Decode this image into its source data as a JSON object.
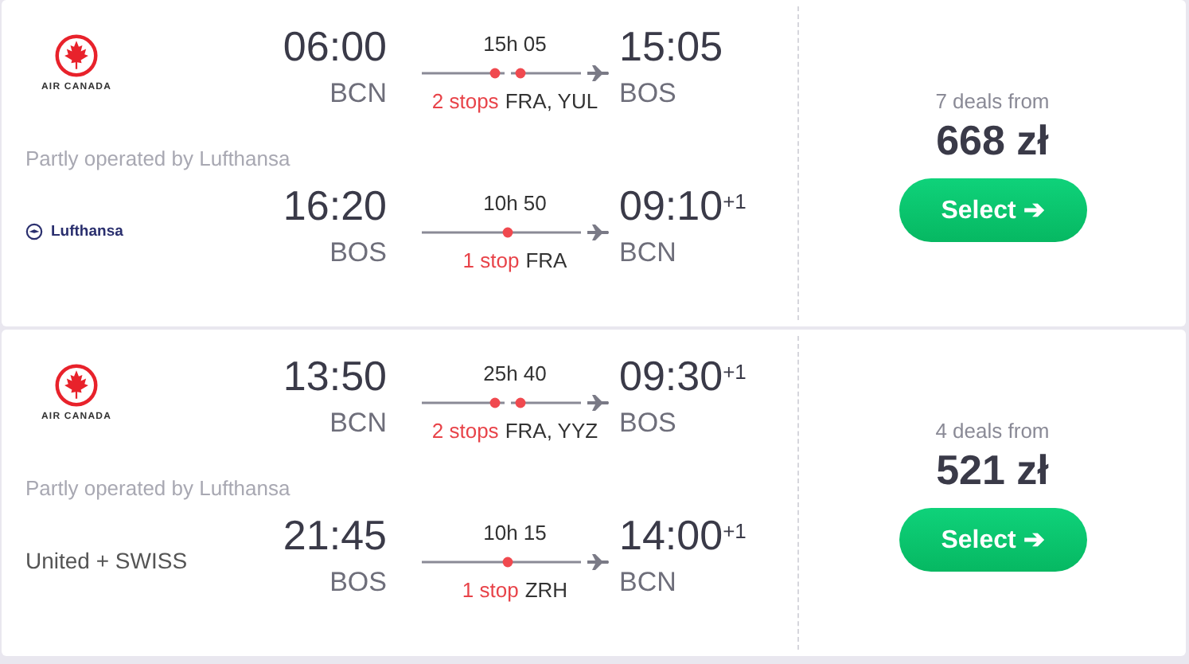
{
  "results": [
    {
      "legs": [
        {
          "kind": "two-stop",
          "carrier": {
            "kind": "air-canada",
            "name": "AIR CANADA"
          },
          "depart_time": "06:00",
          "depart_airport": "BCN",
          "duration": "15h 05",
          "stops_label": "2 stops",
          "stops_airports": "FRA, YUL",
          "arrive_time": "15:05",
          "arrive_airport": "BOS"
        },
        {
          "kind": "one-stop",
          "carrier": {
            "kind": "lufthansa",
            "name": "Lufthansa"
          },
          "depart_time": "16:20",
          "depart_airport": "BOS",
          "duration": "10h 50",
          "stops_label": "1 stop",
          "stops_airports": "FRA",
          "arrive_time": "09:10",
          "arrive_day": "+1",
          "arrive_airport": "BCN"
        }
      ],
      "operated_note": "Partly operated by Lufthansa",
      "deals": "7 deals from",
      "price": "668 zł",
      "button": "Select ➔"
    },
    {
      "legs": [
        {
          "kind": "two-stop",
          "carrier": {
            "kind": "air-canada",
            "name": "AIR CANADA"
          },
          "depart_time": "13:50",
          "depart_airport": "BCN",
          "duration": "25h 40",
          "stops_label": "2 stops",
          "stops_airports": "FRA, YYZ",
          "arrive_time": "09:30",
          "arrive_day": "+1",
          "arrive_airport": "BOS"
        },
        {
          "kind": "one-stop",
          "carrier": {
            "kind": "text",
            "name": "United + SWISS"
          },
          "depart_time": "21:45",
          "depart_airport": "BOS",
          "duration": "10h 15",
          "stops_label": "1 stop",
          "stops_airports": "ZRH",
          "arrive_time": "14:00",
          "arrive_day": "+1",
          "arrive_airport": "BCN"
        }
      ],
      "operated_note": "Partly operated by Lufthansa",
      "deals": "4 deals from",
      "price": "521 zł",
      "button": "Select ➔"
    }
  ]
}
